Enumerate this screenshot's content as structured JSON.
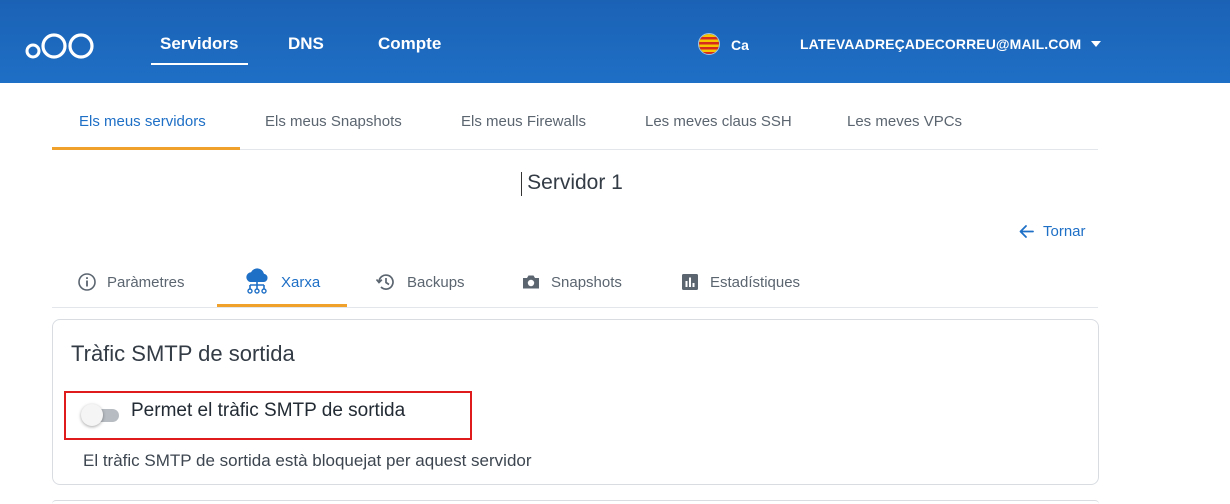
{
  "header": {
    "nav": [
      {
        "label": "Servidors",
        "active": true
      },
      {
        "label": "DNS",
        "active": false
      },
      {
        "label": "Compte",
        "active": false
      }
    ],
    "language": "Ca",
    "email": "LATEVAADREÇADECORREU@MAIL.COM",
    "brand_color": "#1e6fc6"
  },
  "subtabs": [
    {
      "label": "Els meus servidors",
      "active": true
    },
    {
      "label": "Els meus Snapshots",
      "active": false
    },
    {
      "label": "Els meus Firewalls",
      "active": false
    },
    {
      "label": "Les meves claus SSH",
      "active": false
    },
    {
      "label": "Les meves VPCs",
      "active": false
    }
  ],
  "page": {
    "title": "Servidor 1",
    "back_label": "Tornar"
  },
  "server_tabs": [
    {
      "label": "Paràmetres",
      "icon": "info-icon",
      "active": false
    },
    {
      "label": "Xarxa",
      "icon": "cloud-network-icon",
      "active": true
    },
    {
      "label": "Backups",
      "icon": "history-icon",
      "active": false
    },
    {
      "label": "Snapshots",
      "icon": "camera-icon",
      "active": false
    },
    {
      "label": "Estadístiques",
      "icon": "bar-chart-icon",
      "active": false
    }
  ],
  "smtp_card": {
    "title": "Tràfic SMTP de sortida",
    "toggle_label": "Permet el tràfic SMTP de sortida",
    "toggle_on": false,
    "helper": "El tràfic SMTP de sortida està bloquejat per aquest servidor"
  },
  "colors": {
    "accent": "#1e6fc6",
    "tab_indicator": "#f0a12c",
    "highlight": "#e01b1b"
  }
}
